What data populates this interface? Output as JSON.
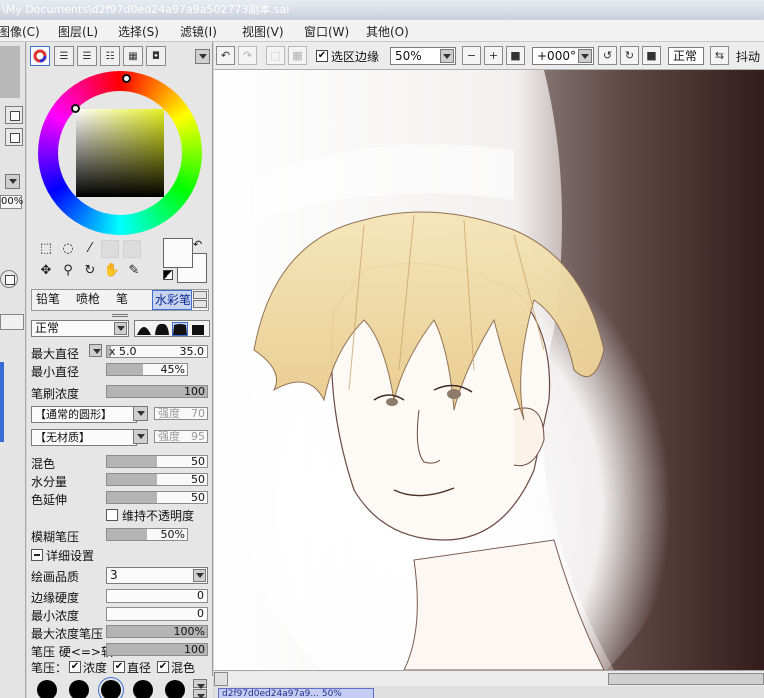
{
  "title": "\\My Documents\\d2f97d0ed24a97a9a502773副本.sai",
  "menu": [
    "图像(C)",
    "图层(L)",
    "选择(S)",
    "滤镜(I)",
    "视图(V)",
    "窗口(W)",
    "其他(O)"
  ],
  "left_strip": {
    "percent": "00%"
  },
  "color_panel": {
    "hue_color": "#e6f020",
    "mode_icons": [
      "color-wheel-icon",
      "rgb-sliders-icon",
      "hsv-sliders-icon",
      "swatches-icon",
      "scratchpad-icon",
      "palette-icon"
    ]
  },
  "brush_tabs": [
    "铅笔",
    "喷枪",
    "笔",
    "水彩笔"
  ],
  "brush_tab_selected": "水彩笔",
  "blend_mode": "正常",
  "params": {
    "max_diameter_label": "最大直径",
    "max_diameter_mult": "x 5.0",
    "max_diameter_value": "35.0",
    "min_diameter_label": "最小直径",
    "min_diameter_value": "45%",
    "min_diameter_level": 45,
    "density_label": "笔刷浓度",
    "density_value": "100",
    "density_level": 100,
    "shape_select": "【通常的圆形】",
    "shape_strength_label": "强度",
    "shape_strength_value": "70",
    "texture_select": "【无材质】",
    "texture_strength_label": "强度",
    "texture_strength_value": "95",
    "blend_label": "混色",
    "blend_value": "50",
    "blend_level": 50,
    "water_label": "水分量",
    "water_value": "50",
    "water_level": 50,
    "extend_label": "色延伸",
    "extend_value": "50",
    "extend_level": 50,
    "keep_opacity_label": "维持不透明度",
    "blur_label": "模糊笔压",
    "blur_value": "50%",
    "blur_level": 50,
    "advanced_label": "详细设置",
    "quality_label": "绘画品质",
    "quality_value": "3",
    "edge_label": "边缘硬度",
    "edge_value": "0",
    "min_density_label": "最小浓度",
    "min_density_value": "0",
    "max_density_label": "最大浓度笔压",
    "max_density_value": "100%",
    "max_density_level": 100,
    "pressure_label": "笔压 硬<=>软",
    "pressure_value": "100",
    "pressure_level": 100,
    "pressure_row_label": "笔压：",
    "pressure_density": "浓度",
    "pressure_diameter": "直径",
    "pressure_blend": "混色"
  },
  "toolbar": {
    "selection_edge_label": "选区边缘",
    "zoom": "50%",
    "rotation": "+000°",
    "mode": "正常",
    "stabilizer_label": "抖动"
  },
  "doc_tab": "d2f97d0ed24a97a9... 50%"
}
